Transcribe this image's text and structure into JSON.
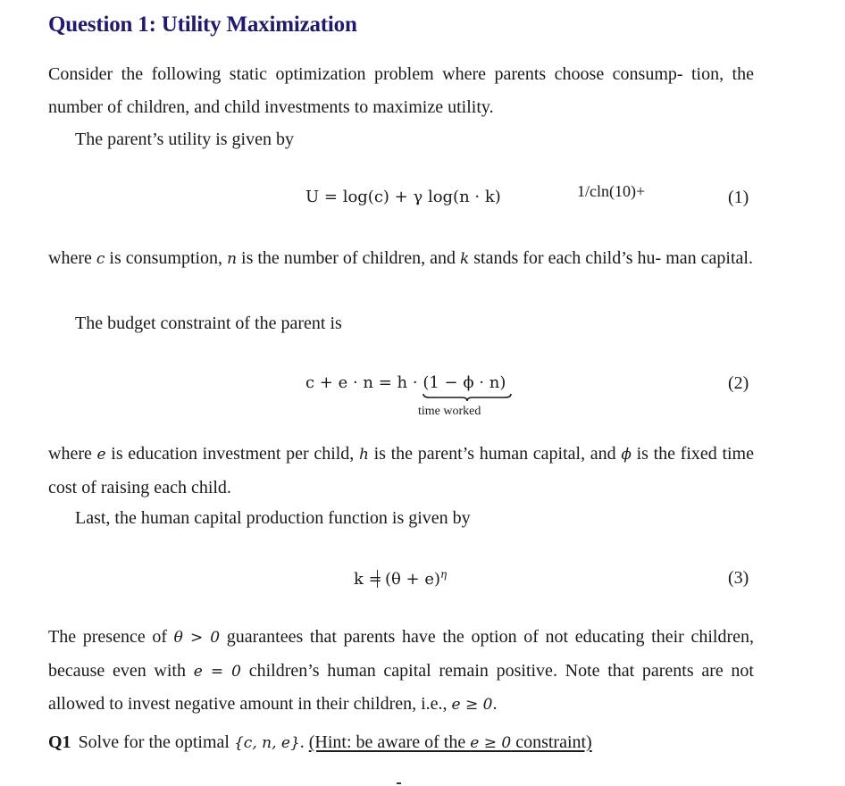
{
  "title": "Question 1: Utility Maximization",
  "paragraphs": {
    "p1_line": "Consider the following static optimization problem where parents choose consump- tion, the number of children, and child investments to maximize utility.",
    "p2": "The parent’s utility is given by",
    "p3_a": "where ",
    "p3_c": "c",
    "p3_b": " is consumption, ",
    "p3_n": "n",
    "p3_d": " is the number of children, and ",
    "p3_k": "k",
    "p3_e": " stands for each child’s hu- man capital.",
    "p4": "The budget constraint of the parent is",
    "p5_a": "where ",
    "p5_e": "e",
    "p5_b": " is education investment per child, ",
    "p5_h": "h",
    "p5_c": " is the parent’s human capital, and ",
    "p5_phi": "ϕ",
    "p5_d": " is the fixed time cost of raising each child.",
    "p6": "Last, the human capital production function is given by",
    "p7_a": "The presence of ",
    "p7_m1": "θ > 0",
    "p7_b": " guarantees that parents have the option of not educating their children, because even with ",
    "p7_m2": "e = 0",
    "p7_c": " children’s human capital remain positive.  Note that parents are not allowed to invest negative amount in their children, i.e., ",
    "p7_m3": "e ≥ 0",
    "p7_d": "."
  },
  "equations": [
    {
      "lhs": "U = log(c) + γ log(n · k)",
      "number": "(1)",
      "overlay_text": "1/cln(10)+"
    },
    {
      "lhs": "c + e · n = h · ",
      "braced": "(1 − ϕ · n)",
      "brace_label": "time worked",
      "number": "(2)"
    },
    {
      "lhs": "k =",
      "rhs": "(θ + e)",
      "exponent": "η",
      "number": "(3)"
    }
  ],
  "question": {
    "label": "Q1",
    "text": "Solve for the optimal ",
    "set": "{c, n, e}",
    "period": ". ",
    "hint_a": "(Hint: be aware of the ",
    "hint_m": "e ≥ 0",
    "hint_b": " constraint)"
  }
}
